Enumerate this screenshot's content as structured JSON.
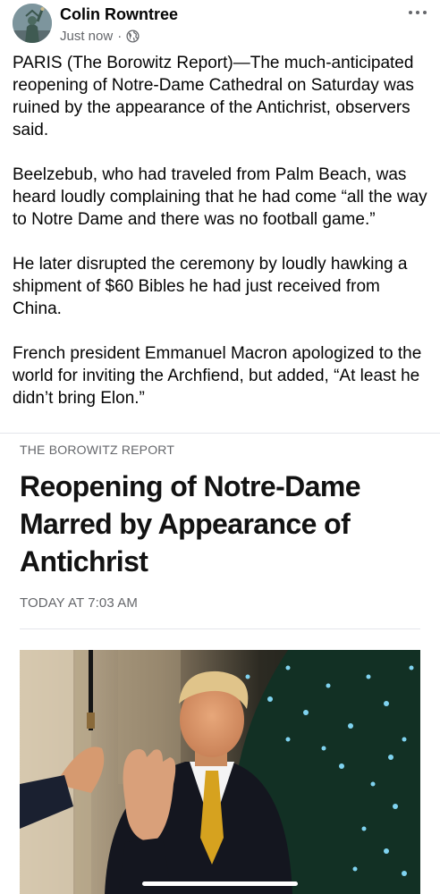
{
  "post": {
    "author": "Colin Rowntree",
    "timestamp": "Just now",
    "separator": "·",
    "privacy_icon": "globe-icon",
    "more_icon": "more-dots-icon",
    "paragraphs": [
      "PARIS (The Borowitz Report)—The much-anticipated reopening of Notre-Dame Cathedral on Saturday was ruined by the appearance of the Antichrist, observers said.",
      "Beelzebub, who had traveled from Palm Beach, was heard loudly complaining that he had come “all the way to Notre Dame and there was no football game.”",
      "He later disrupted the ceremony by loudly hawking a shipment of $60 Bibles he had just received from China.",
      "French president Emmanuel Macron apologized to the world for inviting the Archfiend, but added, “At least he didn’t bring Elon.”"
    ]
  },
  "link_card": {
    "source": "THE BOROWITZ REPORT",
    "headline": "Reopening of Notre-Dame\nMarred by Appearance of\nAntichrist",
    "time": "TODAY AT 7:03 AM"
  },
  "colors": {
    "text": "#050505",
    "secondary_text": "#65676b",
    "divider": "#e4e6eb"
  }
}
